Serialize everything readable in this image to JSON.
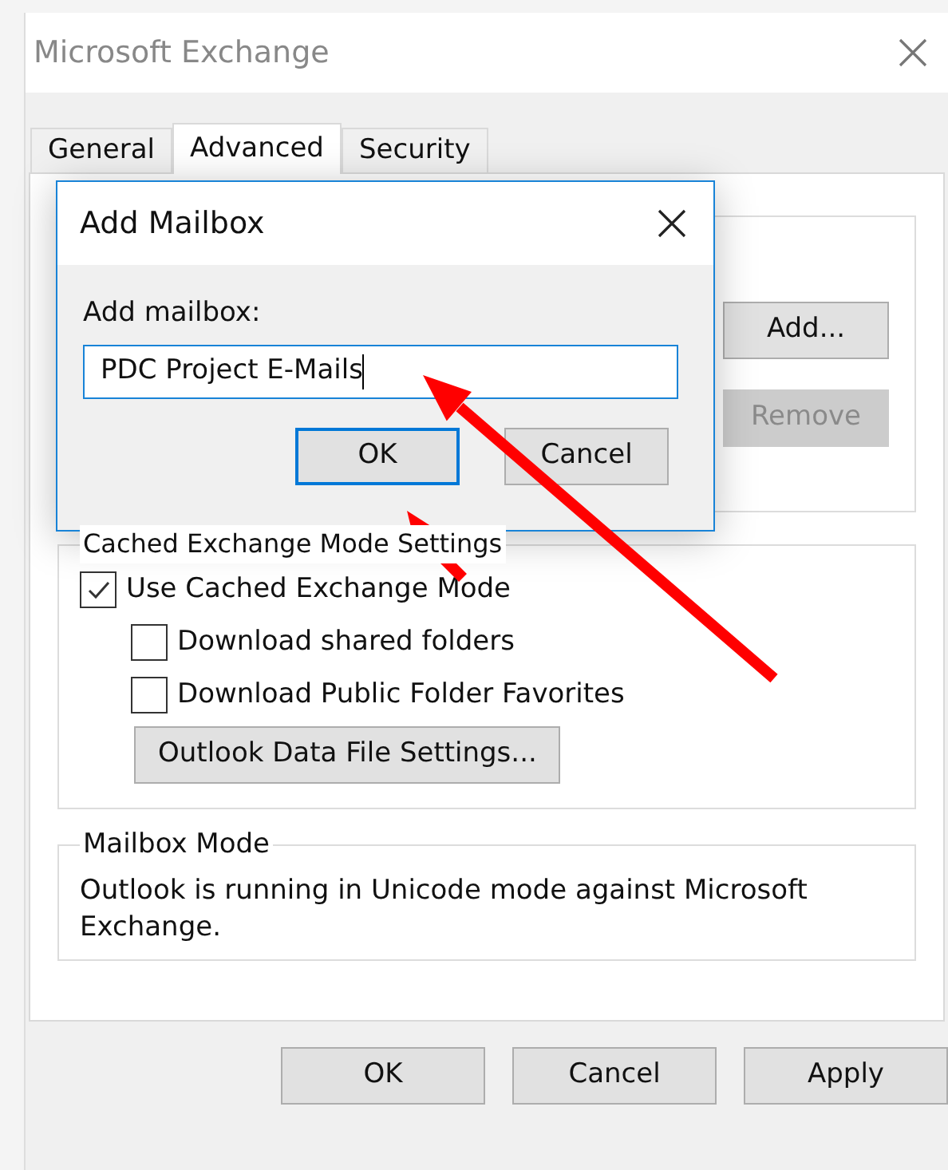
{
  "window": {
    "title": "Microsoft Exchange"
  },
  "tabs": [
    {
      "label": "General",
      "selected": false
    },
    {
      "label": "Advanced",
      "selected": true
    },
    {
      "label": "Security",
      "selected": false
    }
  ],
  "mailboxes_group": {
    "buttons": [
      {
        "label": "Add...",
        "disabled": false
      },
      {
        "label": "Remove",
        "disabled": true
      }
    ]
  },
  "cached_group": {
    "title": "Cached Exchange Mode Settings",
    "options": [
      {
        "label": "Use Cached Exchange Mode",
        "checked": true,
        "children": [
          {
            "label": "Download shared folders",
            "checked": false
          },
          {
            "label": "Download Public Folder Favorites",
            "checked": false
          }
        ]
      }
    ],
    "button": "Outlook Data File Settings..."
  },
  "mailbox_mode": {
    "title": "Mailbox Mode",
    "text": "Outlook is running in Unicode mode against Microsoft Exchange."
  },
  "buttons": [
    {
      "label": "OK",
      "disabled": false
    },
    {
      "label": "Cancel",
      "disabled": false
    },
    {
      "label": "Apply",
      "disabled": false
    }
  ],
  "dialog": {
    "title": "Add Mailbox",
    "field_label": "Add mailbox:",
    "value": "PDC Project E-Mails",
    "buttons": [
      {
        "label": "OK",
        "default": true
      },
      {
        "label": "Cancel",
        "default": false
      }
    ]
  }
}
